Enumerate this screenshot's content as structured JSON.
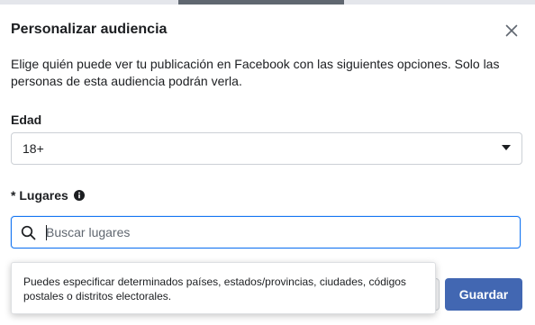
{
  "dialog": {
    "title": "Personalizar audiencia",
    "description": "Elige quién puede ver tu publicación en Facebook con las siguientes opciones. Solo las personas de esta audiencia podrán verla."
  },
  "age": {
    "label": "Edad",
    "value": "18+"
  },
  "locations": {
    "label": "* Lugares",
    "placeholder": "Buscar lugares",
    "tooltip": "Puedes especificar determinados países, estados/provincias, ciudades, códigos postales o distritos electorales."
  },
  "actions": {
    "save_label": "Guardar"
  },
  "colors": {
    "accent": "#1877f2",
    "save_button": "#4267b2"
  },
  "icons": {
    "close": "close-icon",
    "info": "info-icon",
    "search": "search-icon",
    "dropdown": "caret-down-icon"
  }
}
